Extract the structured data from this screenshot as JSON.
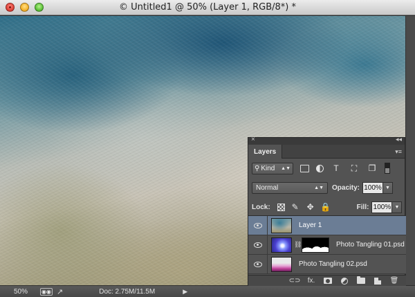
{
  "window": {
    "title": "© Untitled1 @ 50% (Layer 1, RGB/8*) *"
  },
  "status_bar": {
    "zoom": "50%",
    "doc_info": "Doc: 2.75M/11.5M",
    "arrow": "▶"
  },
  "layers_panel": {
    "close_glyph": "×",
    "collapse_glyph": "◂◂",
    "tab_label": "Layers",
    "menu_glyph": "▾≡",
    "filter": {
      "kind_label": "Kind",
      "type_glyph": "T",
      "transform_glyph": "⛶",
      "smart_glyph": "❐"
    },
    "blend_mode": "Normal",
    "opacity_label": "Opacity:",
    "opacity_value": "100%",
    "lock_label": "Lock:",
    "fill_label": "Fill:",
    "fill_value": "100%",
    "layers": [
      {
        "name": "Layer 1",
        "selected": true,
        "visible": true
      },
      {
        "name": "Photo Tangling 01.psd",
        "selected": false,
        "visible": true,
        "has_mask": true
      },
      {
        "name": "Photo Tangling 02.psd",
        "selected": false,
        "visible": true
      }
    ],
    "footer": {
      "link_glyph": "⊂⊃",
      "fx_label": "fx.",
      "trash_glyph": "🗑"
    }
  }
}
